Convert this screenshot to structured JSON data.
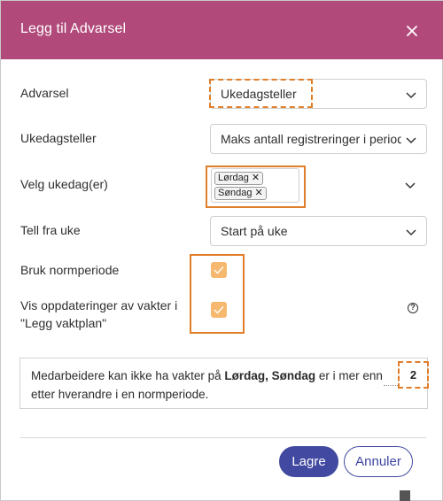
{
  "dialog": {
    "title": "Legg til Advarsel"
  },
  "form": {
    "advarsel": {
      "label": "Advarsel",
      "value": "Ukedagsteller"
    },
    "ukedagsteller": {
      "label": "Ukedagsteller",
      "value": "Maks antall registreringer i periode"
    },
    "velg_ukedag": {
      "label": "Velg ukedag(er)",
      "tags": [
        "Lørdag",
        "Søndag"
      ]
    },
    "tell_fra_uke": {
      "label": "Tell fra uke",
      "value": "Start på uke"
    },
    "bruk_normperiode": {
      "label": "Bruk normperiode",
      "checked": true
    },
    "vis_oppdateringer": {
      "label_line1": "Vis oppdateringer av vakter i",
      "label_line2": "\"Legg vaktplan\"",
      "checked": true,
      "help": "?"
    }
  },
  "info": {
    "part1": "Medarbeidere kan ikke ha vakter på ",
    "days": "Lørdag, Søndag",
    "part2": " er i mer enn",
    "line2": "etter hverandre i en normperiode.",
    "count": "2"
  },
  "actions": {
    "save_label": "Lagre",
    "cancel_label": "Annuler"
  },
  "colors": {
    "header": "#b14a7a",
    "highlight": "#e07e2a",
    "primary": "#4149a0",
    "checkbox": "#f6b86e"
  }
}
